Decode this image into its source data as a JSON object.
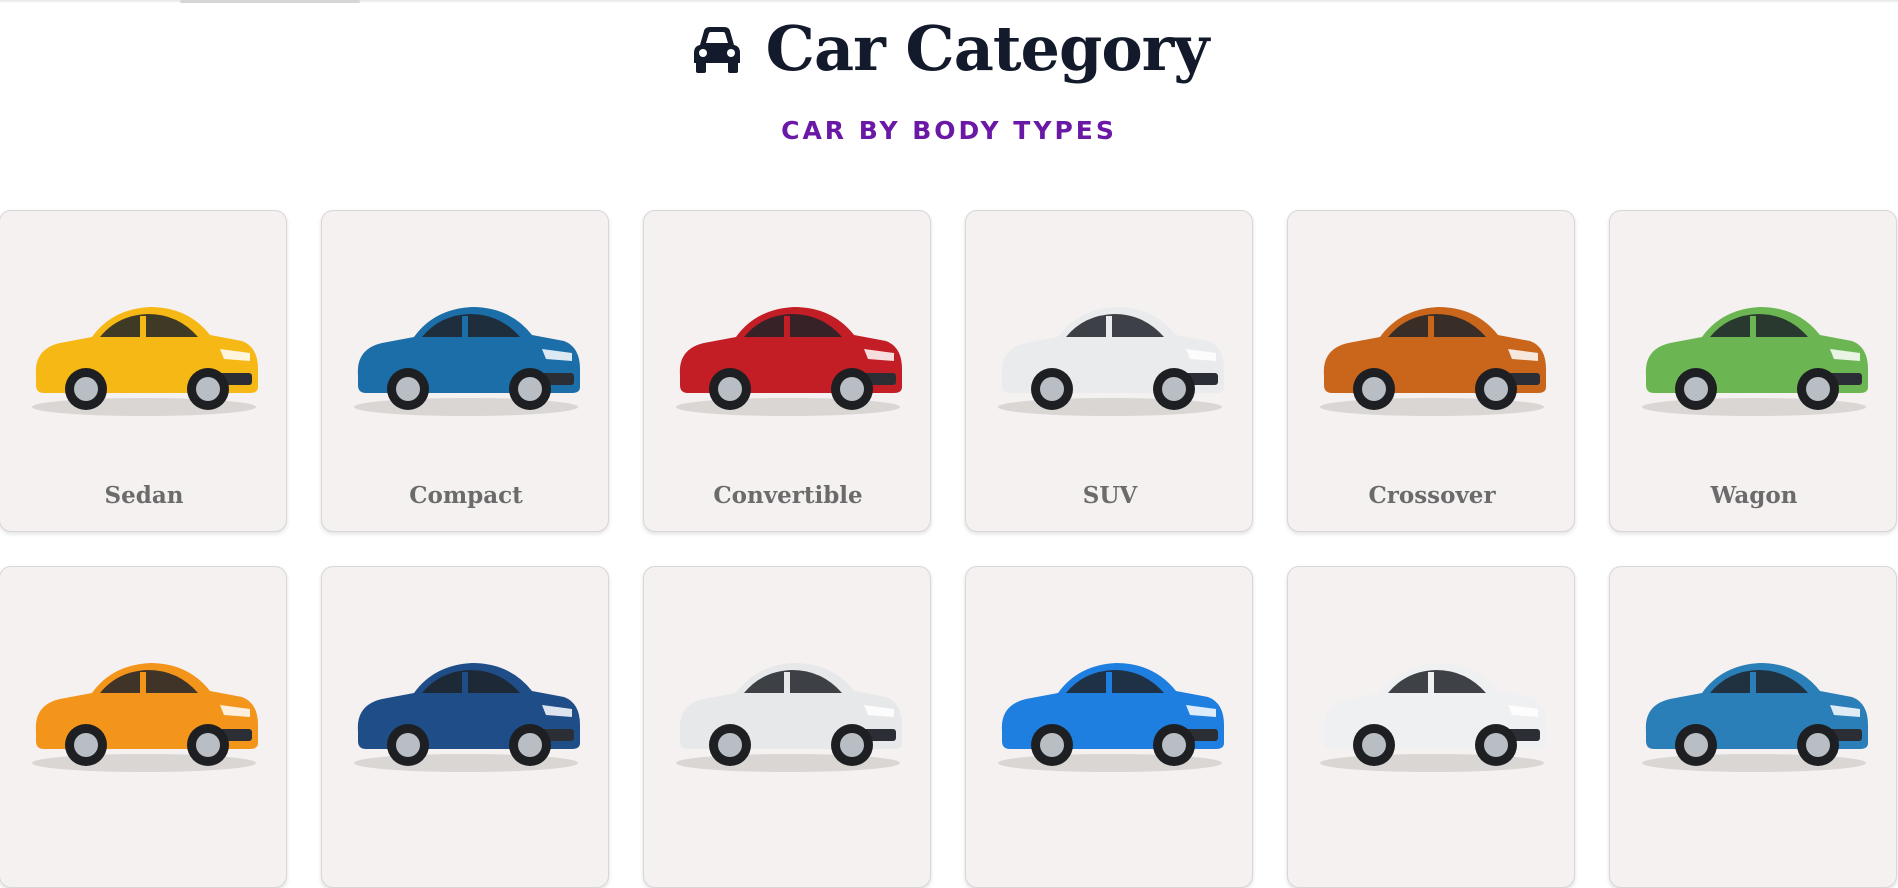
{
  "header": {
    "title": "Car Category",
    "subtitle": "CAR BY BODY TYPES",
    "icon": "car-icon",
    "title_color": "#131a2b",
    "subtitle_color": "#6a19a6"
  },
  "categories": [
    {
      "label": "Sedan",
      "color": "#f6b814",
      "image": "yellow-sedan"
    },
    {
      "label": "Compact",
      "color": "#1b6ea8",
      "image": "blue-compact-suv"
    },
    {
      "label": "Convertible",
      "color": "#c31d25",
      "image": "red-convertible"
    },
    {
      "label": "SUV",
      "color": "#e9ebed",
      "image": "white-suv"
    },
    {
      "label": "Crossover",
      "color": "#c9661c",
      "image": "orange-crossover"
    },
    {
      "label": "Wagon",
      "color": "#6bb653",
      "image": "green-wagon"
    },
    {
      "color": "#f3941b",
      "image": "orange-sports-car"
    },
    {
      "color": "#1f4d88",
      "image": "blue-pickup-truck"
    },
    {
      "color": "#e6e8ea",
      "image": "white-minivan"
    },
    {
      "color": "#1e7fe0",
      "image": "blue-coupe"
    },
    {
      "color": "#eef0f2",
      "image": "white-electric-hatchback"
    },
    {
      "color": "#2a7fb8",
      "image": "blue-luxury-coupe"
    }
  ],
  "style": {
    "card_background": "#f4f1f0",
    "label_color": "#6b6b6b"
  }
}
